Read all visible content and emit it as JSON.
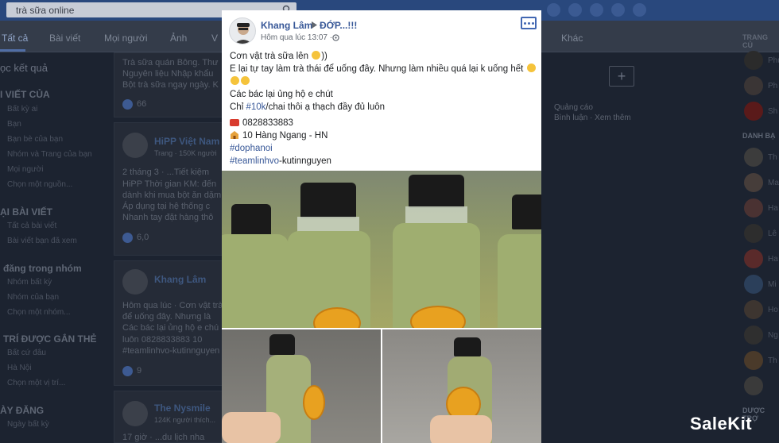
{
  "search": {
    "value": "trà sữa online"
  },
  "tabs": [
    "Tất cả",
    "Bài viết",
    "Mọi người",
    "Ảnh",
    "V",
    "Khác"
  ],
  "left_sidebar": {
    "title": "ọc kết quả",
    "sections": [
      {
        "heading": "I VIẾT CỦA",
        "items": [
          "Bất kỳ ai",
          "Bạn",
          "Bạn bè của bạn",
          "Nhóm và Trang của bạn",
          "Mọi người",
          "Chọn một nguồn..."
        ]
      },
      {
        "heading": "ẠI BÀI VIẾT",
        "items": [
          "Tất cả bài viết",
          "Bài viết bạn đã xem"
        ]
      },
      {
        "heading": "đăng trong nhóm",
        "items": [
          "Nhóm bất kỳ",
          "Nhóm của bạn",
          "Chọn một nhóm..."
        ]
      },
      {
        "heading": "TRÍ ĐƯỢC GẮN THẺ",
        "items": [
          "Bất cứ đâu",
          "Hà Nội",
          "Chọn một vị trí..."
        ]
      },
      {
        "heading": "ÀY ĐĂNG",
        "items": [
          "Ngày bất kỳ"
        ]
      }
    ]
  },
  "feed_background": [
    {
      "lines": [
        "Trà sữa quán Bông. Thư",
        "Nguyên liệu Nhập khẩu",
        "Bột trà sữa ngay ngày. K"
      ],
      "reactions": "66"
    },
    {
      "name": "HiPP Việt Nam",
      "meta": "Trang · 150K người",
      "lines": [
        "2 tháng 3 · ...Tiết kiệm",
        "HiPP Thời gian KM: đến",
        "dành khi mua bột ăn dặm",
        "Áp dụng tại hệ thống c",
        "Nhanh tay đặt hàng thô"
      ],
      "reactions": "6,0"
    },
    {
      "name": "Khang Lâm",
      "lines": [
        "Hôm qua lúc · Cơn vật trà",
        "để uống đây. Nhưng là",
        "Các bác lại ủng hộ e chú",
        "luôn 0828833883 10",
        "#teamlinhvo-kutinnguyen"
      ],
      "reactions": "9"
    },
    {
      "name": "The Nysmile",
      "meta": "124K người thích...",
      "lines": [
        "17 giờ · ...du lịch nha"
      ]
    }
  ],
  "mid_ghost": [
    "Quảng cáo",
    "Bình luận · Xem thêm"
  ],
  "right_sidebar": {
    "headings": [
      "TRANG CỦ",
      "DANH BẠ",
      "DƯỢC TRỢ"
    ],
    "names": [
      "Phú",
      "Ph",
      "Sh",
      "Th",
      "Ma",
      "Ha",
      "Lê",
      "Ha",
      "Mi",
      "Ho",
      "Ng",
      "Th"
    ]
  },
  "post": {
    "author": "Khang Lâm",
    "group": "ĐỚP...!!!",
    "timestamp": "Hôm qua lúc 13:07 ·",
    "lines": [
      "Cơn vật trà sữa lên",
      "E lại tự tay làm trà thái để uống đây. Nhưng làm nhiều quá lại k uống hết",
      "",
      "Các bác lại ủng hộ e chút",
      "Chỉ",
      "0828833883",
      "10 Hàng Ngang - HN",
      "#dophanoi",
      "#teamlinhvo"
    ],
    "line1_suffix": "))",
    "price_tag": "#10k",
    "price_rest": "/chai thôi ạ thạch đầy đủ luôn",
    "hashtag2_rest": "-kutinnguyen"
  },
  "watermark": "SaleKit",
  "colors": {
    "accent": "#385898",
    "fb_blue": "#4267b2",
    "dim_bg": "#1c2330"
  }
}
